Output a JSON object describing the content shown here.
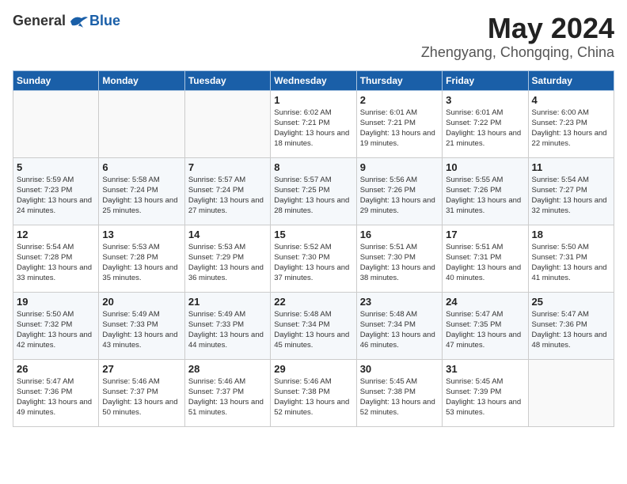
{
  "header": {
    "logo": {
      "general": "General",
      "blue": "Blue"
    },
    "title": "May 2024",
    "location": "Zhengyang, Chongqing, China"
  },
  "weekdays": [
    "Sunday",
    "Monday",
    "Tuesday",
    "Wednesday",
    "Thursday",
    "Friday",
    "Saturday"
  ],
  "weeks": [
    [
      {
        "day": "",
        "sunrise": "",
        "sunset": "",
        "daylight": ""
      },
      {
        "day": "",
        "sunrise": "",
        "sunset": "",
        "daylight": ""
      },
      {
        "day": "",
        "sunrise": "",
        "sunset": "",
        "daylight": ""
      },
      {
        "day": "1",
        "sunrise": "Sunrise: 6:02 AM",
        "sunset": "Sunset: 7:21 PM",
        "daylight": "Daylight: 13 hours and 18 minutes."
      },
      {
        "day": "2",
        "sunrise": "Sunrise: 6:01 AM",
        "sunset": "Sunset: 7:21 PM",
        "daylight": "Daylight: 13 hours and 19 minutes."
      },
      {
        "day": "3",
        "sunrise": "Sunrise: 6:01 AM",
        "sunset": "Sunset: 7:22 PM",
        "daylight": "Daylight: 13 hours and 21 minutes."
      },
      {
        "day": "4",
        "sunrise": "Sunrise: 6:00 AM",
        "sunset": "Sunset: 7:23 PM",
        "daylight": "Daylight: 13 hours and 22 minutes."
      }
    ],
    [
      {
        "day": "5",
        "sunrise": "Sunrise: 5:59 AM",
        "sunset": "Sunset: 7:23 PM",
        "daylight": "Daylight: 13 hours and 24 minutes."
      },
      {
        "day": "6",
        "sunrise": "Sunrise: 5:58 AM",
        "sunset": "Sunset: 7:24 PM",
        "daylight": "Daylight: 13 hours and 25 minutes."
      },
      {
        "day": "7",
        "sunrise": "Sunrise: 5:57 AM",
        "sunset": "Sunset: 7:24 PM",
        "daylight": "Daylight: 13 hours and 27 minutes."
      },
      {
        "day": "8",
        "sunrise": "Sunrise: 5:57 AM",
        "sunset": "Sunset: 7:25 PM",
        "daylight": "Daylight: 13 hours and 28 minutes."
      },
      {
        "day": "9",
        "sunrise": "Sunrise: 5:56 AM",
        "sunset": "Sunset: 7:26 PM",
        "daylight": "Daylight: 13 hours and 29 minutes."
      },
      {
        "day": "10",
        "sunrise": "Sunrise: 5:55 AM",
        "sunset": "Sunset: 7:26 PM",
        "daylight": "Daylight: 13 hours and 31 minutes."
      },
      {
        "day": "11",
        "sunrise": "Sunrise: 5:54 AM",
        "sunset": "Sunset: 7:27 PM",
        "daylight": "Daylight: 13 hours and 32 minutes."
      }
    ],
    [
      {
        "day": "12",
        "sunrise": "Sunrise: 5:54 AM",
        "sunset": "Sunset: 7:28 PM",
        "daylight": "Daylight: 13 hours and 33 minutes."
      },
      {
        "day": "13",
        "sunrise": "Sunrise: 5:53 AM",
        "sunset": "Sunset: 7:28 PM",
        "daylight": "Daylight: 13 hours and 35 minutes."
      },
      {
        "day": "14",
        "sunrise": "Sunrise: 5:53 AM",
        "sunset": "Sunset: 7:29 PM",
        "daylight": "Daylight: 13 hours and 36 minutes."
      },
      {
        "day": "15",
        "sunrise": "Sunrise: 5:52 AM",
        "sunset": "Sunset: 7:30 PM",
        "daylight": "Daylight: 13 hours and 37 minutes."
      },
      {
        "day": "16",
        "sunrise": "Sunrise: 5:51 AM",
        "sunset": "Sunset: 7:30 PM",
        "daylight": "Daylight: 13 hours and 38 minutes."
      },
      {
        "day": "17",
        "sunrise": "Sunrise: 5:51 AM",
        "sunset": "Sunset: 7:31 PM",
        "daylight": "Daylight: 13 hours and 40 minutes."
      },
      {
        "day": "18",
        "sunrise": "Sunrise: 5:50 AM",
        "sunset": "Sunset: 7:31 PM",
        "daylight": "Daylight: 13 hours and 41 minutes."
      }
    ],
    [
      {
        "day": "19",
        "sunrise": "Sunrise: 5:50 AM",
        "sunset": "Sunset: 7:32 PM",
        "daylight": "Daylight: 13 hours and 42 minutes."
      },
      {
        "day": "20",
        "sunrise": "Sunrise: 5:49 AM",
        "sunset": "Sunset: 7:33 PM",
        "daylight": "Daylight: 13 hours and 43 minutes."
      },
      {
        "day": "21",
        "sunrise": "Sunrise: 5:49 AM",
        "sunset": "Sunset: 7:33 PM",
        "daylight": "Daylight: 13 hours and 44 minutes."
      },
      {
        "day": "22",
        "sunrise": "Sunrise: 5:48 AM",
        "sunset": "Sunset: 7:34 PM",
        "daylight": "Daylight: 13 hours and 45 minutes."
      },
      {
        "day": "23",
        "sunrise": "Sunrise: 5:48 AM",
        "sunset": "Sunset: 7:34 PM",
        "daylight": "Daylight: 13 hours and 46 minutes."
      },
      {
        "day": "24",
        "sunrise": "Sunrise: 5:47 AM",
        "sunset": "Sunset: 7:35 PM",
        "daylight": "Daylight: 13 hours and 47 minutes."
      },
      {
        "day": "25",
        "sunrise": "Sunrise: 5:47 AM",
        "sunset": "Sunset: 7:36 PM",
        "daylight": "Daylight: 13 hours and 48 minutes."
      }
    ],
    [
      {
        "day": "26",
        "sunrise": "Sunrise: 5:47 AM",
        "sunset": "Sunset: 7:36 PM",
        "daylight": "Daylight: 13 hours and 49 minutes."
      },
      {
        "day": "27",
        "sunrise": "Sunrise: 5:46 AM",
        "sunset": "Sunset: 7:37 PM",
        "daylight": "Daylight: 13 hours and 50 minutes."
      },
      {
        "day": "28",
        "sunrise": "Sunrise: 5:46 AM",
        "sunset": "Sunset: 7:37 PM",
        "daylight": "Daylight: 13 hours and 51 minutes."
      },
      {
        "day": "29",
        "sunrise": "Sunrise: 5:46 AM",
        "sunset": "Sunset: 7:38 PM",
        "daylight": "Daylight: 13 hours and 52 minutes."
      },
      {
        "day": "30",
        "sunrise": "Sunrise: 5:45 AM",
        "sunset": "Sunset: 7:38 PM",
        "daylight": "Daylight: 13 hours and 52 minutes."
      },
      {
        "day": "31",
        "sunrise": "Sunrise: 5:45 AM",
        "sunset": "Sunset: 7:39 PM",
        "daylight": "Daylight: 13 hours and 53 minutes."
      },
      {
        "day": "",
        "sunrise": "",
        "sunset": "",
        "daylight": ""
      }
    ]
  ]
}
